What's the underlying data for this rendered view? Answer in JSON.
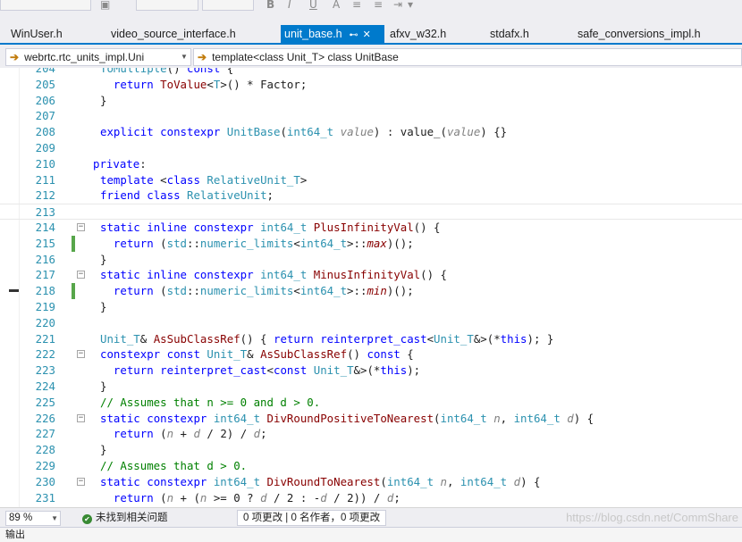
{
  "tabs": [
    {
      "label": "WinUser.h",
      "active": false
    },
    {
      "label": "video_source_interface.h",
      "active": false
    },
    {
      "label": "unit_base.h",
      "active": true
    },
    {
      "label": "afxv_w32.h",
      "active": false
    },
    {
      "label": "stdafx.h",
      "active": false
    },
    {
      "label": "safe_conversions_impl.h",
      "active": false
    }
  ],
  "navbar": {
    "project": "webrtc.rtc_units_impl.Uni",
    "scope": "template<class Unit_T> class UnitBase"
  },
  "editor": {
    "lines": [
      {
        "n": "204",
        "html": "<span class=\"ty\">ToMultiple</span>() <span class=\"kw\">const</span> {"
      },
      {
        "n": "205",
        "html": "  <span class=\"kw\">return</span> <span class=\"fn\">ToValue</span>&lt;<span class=\"ty\">T</span>&gt;() * <span class=\"pn\" style=\"font-style:normal;color:#1e1e1e\">Factor</span>;"
      },
      {
        "n": "206",
        "html": "}"
      },
      {
        "n": "207",
        "html": ""
      },
      {
        "n": "208",
        "html": "<span class=\"kw\">explicit</span> <span class=\"kw\">constexpr</span> <span class=\"ty\">UnitBase</span>(<span class=\"ty\">int64_t</span> <span class=\"pn\">value</span>) : value_(<span class=\"pn\">value</span>) {}"
      },
      {
        "n": "209",
        "html": ""
      },
      {
        "n": "210",
        "html": "<span class=\"kw\">private</span>:"
      },
      {
        "n": "211",
        "html": "<span class=\"kw\">template</span> &lt;<span class=\"kw\">class</span> <span class=\"ty\">RelativeUnit_T</span>&gt;"
      },
      {
        "n": "212",
        "html": "<span class=\"kw\">friend</span> <span class=\"kw\">class</span> <span class=\"ty\">RelativeUnit</span>;"
      },
      {
        "n": "213",
        "html": ""
      },
      {
        "n": "214",
        "html": "<span class=\"kw\">static</span> <span class=\"kw\">inline</span> <span class=\"kw\">constexpr</span> <span class=\"ty\">int64_t</span> <span class=\"fn\">PlusInfinityVal</span>() {",
        "fold": true
      },
      {
        "n": "215",
        "html": "  <span class=\"kw\">return</span> (<span class=\"ty\">std</span>::<span class=\"ty\">numeric_limits</span>&lt;<span class=\"ty\">int64_t</span>&gt;::<span class=\"pn\" style=\"color:#880000\">max</span>)();",
        "chg": true
      },
      {
        "n": "216",
        "html": "}"
      },
      {
        "n": "217",
        "html": "<span class=\"kw\">static</span> <span class=\"kw\">inline</span> <span class=\"kw\">constexpr</span> <span class=\"ty\">int64_t</span> <span class=\"fn\">MinusInfinityVal</span>() {",
        "fold": true
      },
      {
        "n": "218",
        "html": "  <span class=\"kw\">return</span> (<span class=\"ty\">std</span>::<span class=\"ty\">numeric_limits</span>&lt;<span class=\"ty\">int64_t</span>&gt;::<span class=\"pn\" style=\"color:#880000\">min</span>)();",
        "chg": true,
        "mark": true
      },
      {
        "n": "219",
        "html": "}"
      },
      {
        "n": "220",
        "html": ""
      },
      {
        "n": "221",
        "html": "<span class=\"ty\">Unit_T</span>&amp; <span class=\"fn\">AsSubClassRef</span>() { <span class=\"kw\">return</span> <span class=\"kw\">reinterpret_cast</span>&lt;<span class=\"ty\">Unit_T</span>&amp;&gt;(*<span class=\"kw\">this</span>); }"
      },
      {
        "n": "222",
        "html": "<span class=\"kw\">constexpr</span> <span class=\"kw\">const</span> <span class=\"ty\">Unit_T</span>&amp; <span class=\"fn\">AsSubClassRef</span>() <span class=\"kw\">const</span> {",
        "fold": true
      },
      {
        "n": "223",
        "html": "  <span class=\"kw\">return</span> <span class=\"kw\">reinterpret_cast</span>&lt;<span class=\"kw\">const</span> <span class=\"ty\">Unit_T</span>&amp;&gt;(*<span class=\"kw\">this</span>);"
      },
      {
        "n": "224",
        "html": "}"
      },
      {
        "n": "225",
        "html": "<span class=\"cm\">// Assumes that n &gt;= 0 and d &gt; 0.</span>"
      },
      {
        "n": "226",
        "html": "<span class=\"kw\">static</span> <span class=\"kw\">constexpr</span> <span class=\"ty\">int64_t</span> <span class=\"fn\">DivRoundPositiveToNearest</span>(<span class=\"ty\">int64_t</span> <span class=\"pn\">n</span>, <span class=\"ty\">int64_t</span> <span class=\"pn\">d</span>) {",
        "fold": true
      },
      {
        "n": "227",
        "html": "  <span class=\"kw\">return</span> (<span class=\"pn\">n</span> + <span class=\"pn\">d</span> / 2) / <span class=\"pn\">d</span>;"
      },
      {
        "n": "228",
        "html": "}"
      },
      {
        "n": "229",
        "html": "<span class=\"cm\">// Assumes that d &gt; 0.</span>"
      },
      {
        "n": "230",
        "html": "<span class=\"kw\">static</span> <span class=\"kw\">constexpr</span> <span class=\"ty\">int64_t</span> <span class=\"fn\">DivRoundToNearest</span>(<span class=\"ty\">int64_t</span> <span class=\"pn\">n</span>, <span class=\"ty\">int64_t</span> <span class=\"pn\">d</span>) {",
        "fold": true
      },
      {
        "n": "231",
        "html": "  <span class=\"kw\">return</span> (<span class=\"pn\">n</span> + (<span class=\"pn\">n</span> &gt;= 0 ? <span class=\"pn\">d</span> / 2 : -<span class=\"pn\">d</span> / 2)) / <span class=\"pn\">d</span>;"
      },
      {
        "n": "232",
        "html": "}"
      }
    ]
  },
  "status": {
    "zoom": "89 %",
    "issues": "未找到相关问题",
    "changes": "0 项更改 | 0 名作者，0 项更改",
    "watermark": "https://blog.csdn.net/CommShare"
  },
  "output": {
    "label": "输出"
  }
}
